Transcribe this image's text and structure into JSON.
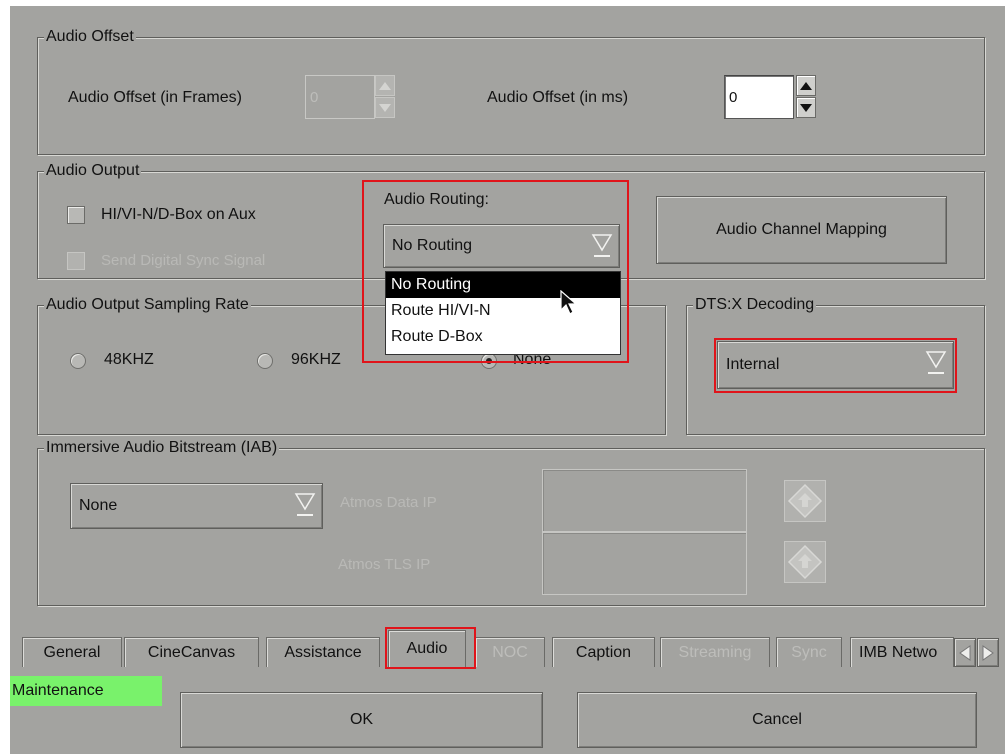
{
  "audio_offset": {
    "title": "Audio Offset",
    "frames_label": "Audio Offset (in Frames)",
    "frames_value": "0",
    "ms_label": "Audio Offset (in ms)",
    "ms_value": "0"
  },
  "audio_output": {
    "title": "Audio Output",
    "checkbox_aux": "HI/VI-N/D-Box on Aux",
    "checkbox_sync": "Send Digital Sync Signal",
    "routing_label": "Audio Routing:",
    "routing_value": "No Routing",
    "routing_options": [
      "No Routing",
      "Route HI/VI-N",
      "Route D-Box"
    ],
    "channel_mapping_button": "Audio Channel Mapping"
  },
  "sampling_rate": {
    "title": "Audio Output Sampling Rate",
    "options": [
      "48KHZ",
      "96KHZ",
      "None"
    ],
    "selected": "None"
  },
  "dtsx": {
    "title": "DTS:X Decoding",
    "value": "Internal"
  },
  "iab": {
    "title": "Immersive Audio Bitstream (IAB)",
    "value": "None",
    "atmos_data_ip_label": "Atmos Data IP",
    "atmos_tls_ip_label": "Atmos TLS IP"
  },
  "tabs": [
    {
      "label": "General",
      "enabled": true
    },
    {
      "label": "CineCanvas",
      "enabled": true
    },
    {
      "label": "Assistance",
      "enabled": true
    },
    {
      "label": "Audio",
      "enabled": true,
      "active": true
    },
    {
      "label": "NOC",
      "enabled": false
    },
    {
      "label": "Caption",
      "enabled": true
    },
    {
      "label": "Streaming",
      "enabled": false
    },
    {
      "label": "Sync",
      "enabled": false
    },
    {
      "label": "IMB Netwo",
      "enabled": true
    }
  ],
  "footer": {
    "status": "Maintenance",
    "ok_label": "OK",
    "cancel_label": "Cancel"
  },
  "colors": {
    "panel_bg": "#a3a3a0",
    "highlight_red": "#e0141a",
    "status_green": "#79f26b"
  }
}
